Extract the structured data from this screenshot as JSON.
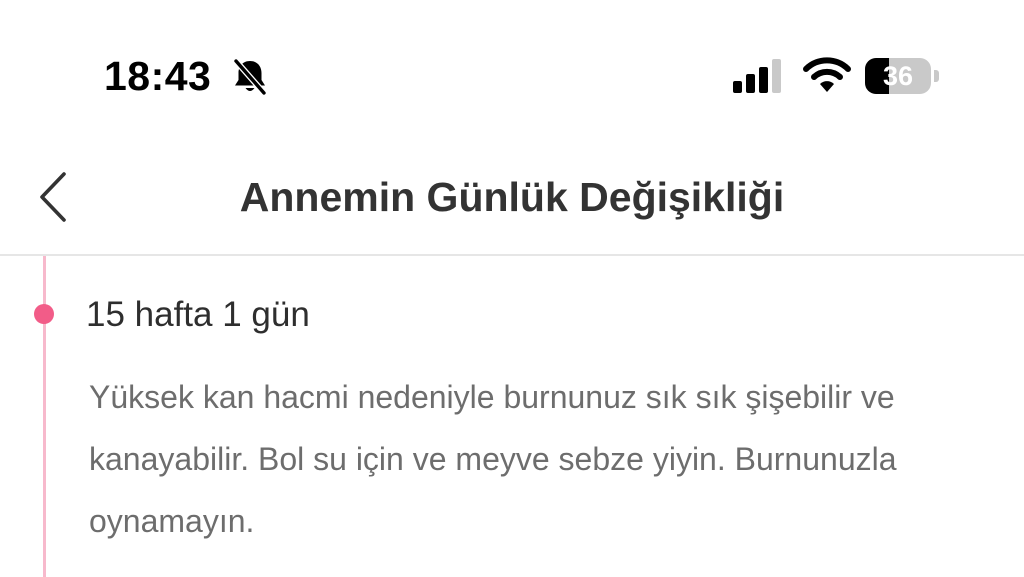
{
  "status_bar": {
    "time": "18:43",
    "battery_level": "36",
    "battery_fraction": 0.36,
    "icons": [
      "bell-slash-icon",
      "cellular-signal-icon",
      "wifi-icon",
      "battery-icon"
    ]
  },
  "header": {
    "title": "Annemin Günlük Değişikliği",
    "back_icon": "chevron-left-icon"
  },
  "timeline": {
    "entries": [
      {
        "title": "15 hafta 1 gün",
        "text": "Yüksek kan hacmi nedeniyle burnunuz sık sık şişebilir ve kanayabilir. Bol su için ve meyve sebze yiyin. Burnunuzla oynamayın."
      }
    ]
  },
  "colors": {
    "accent": "#f25c88",
    "timeline_line": "#f7b9cc",
    "title_text": "#333333",
    "body_text": "#6d6d6d",
    "divider": "#e6e6e6"
  }
}
